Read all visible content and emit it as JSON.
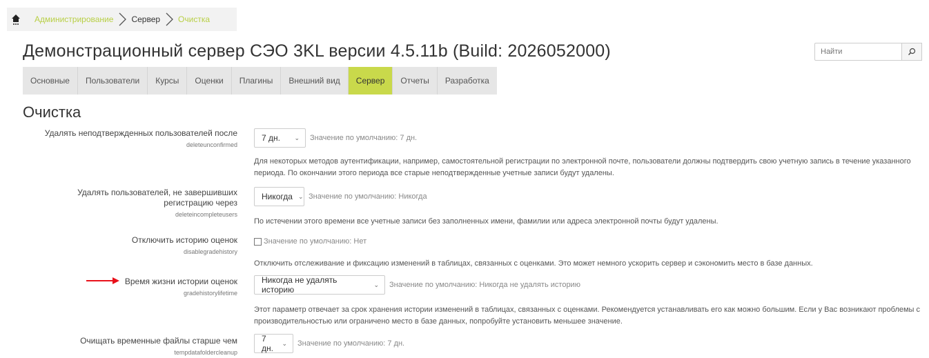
{
  "breadcrumb": {
    "items": [
      "Администрирование",
      "Сервер",
      "Очистка"
    ],
    "colors": {
      "link": "#b8cf45",
      "current": "#333333"
    }
  },
  "header": {
    "title": "Демонстрационный сервер СЭО 3KL версии 4.5.11b (Build: 2026052000)",
    "search_placeholder": "Найти"
  },
  "tabs": [
    {
      "label": "Основные",
      "active": false
    },
    {
      "label": "Пользователи",
      "active": false
    },
    {
      "label": "Курсы",
      "active": false
    },
    {
      "label": "Оценки",
      "active": false
    },
    {
      "label": "Плагины",
      "active": false
    },
    {
      "label": "Внешний вид",
      "active": false
    },
    {
      "label": "Сервер",
      "active": true
    },
    {
      "label": "Отчеты",
      "active": false
    },
    {
      "label": "Разработка",
      "active": false
    }
  ],
  "accent_color": "#c9d94b",
  "section_title": "Очистка",
  "settings": [
    {
      "label": "Удалять неподтвержденных пользователей после",
      "name": "deleteunconfirmed",
      "value": "7 дн.",
      "default": "Значение по умолчанию: 7 дн.",
      "description": "Для некоторых методов аутентификации, например, самостоятельной регистрации по электронной почте, пользователи должны подтвердить свою учетную запись в течение указанного периода. По окончании этого периода все старые неподтвержденные учетные записи будут удалены."
    },
    {
      "label": "Удалять пользователей, не завершивших регистрацию через",
      "name": "deleteincompleteusers",
      "value": "Никогда",
      "default": "Значение по умолчанию: Никогда",
      "description": "По истечении этого времени все учетные записи без заполненных имени, фамилии или адреса электронной почты будут удалены."
    },
    {
      "label": "Отключить историю оценок",
      "name": "disablegradehistory",
      "checked": false,
      "default": "Значение по умолчанию: Нет",
      "description": "Отключить отслеживание и фиксацию изменений в таблицах, связанных с оценками. Это может немного ускорить сервер и сэкономить место в базе данных."
    },
    {
      "label": "Время жизни истории оценок",
      "name": "gradehistorylifetime",
      "value": "Никогда не удалять историю",
      "default": "Значение по умолчанию: Никогда не удалять историю",
      "description": "Этот параметр отвечает за срок хранения истории изменений в таблицах, связанных с оценками. Рекомендуется устанавливать его как можно большим. Если у Вас возникают проблемы с производительностью или ограничено место в базе данных, попробуйте установить меньшее значение."
    },
    {
      "label": "Очищать временные файлы старше чем",
      "name": "tempdatafoldercleanup",
      "value": "7 дн.",
      "default": "Значение по умолчанию: 7 дн."
    }
  ],
  "annotation_arrow_color": "#e8101a"
}
